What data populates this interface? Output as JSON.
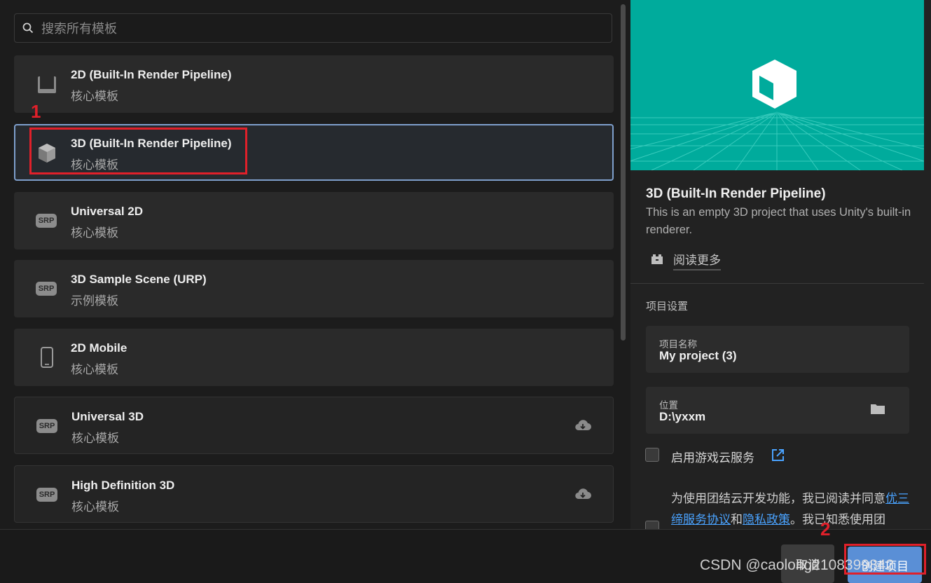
{
  "search": {
    "placeholder": "搜索所有模板"
  },
  "templates": [
    {
      "title": "2D (Built-In Render Pipeline)",
      "subtitle": "核心模板",
      "icon": "square-2d-icon"
    },
    {
      "title": "3D (Built-In Render Pipeline)",
      "subtitle": "核心模板",
      "icon": "cube-3d-icon",
      "selected": true
    },
    {
      "title": "Universal 2D",
      "subtitle": "核心模板",
      "icon": "srp-icon",
      "icon_text": "SRP"
    },
    {
      "title": "3D Sample Scene (URP)",
      "subtitle": "示例模板",
      "icon": "srp-icon",
      "icon_text": "SRP"
    },
    {
      "title": "2D Mobile",
      "subtitle": "核心模板",
      "icon": "mobile-icon"
    },
    {
      "title": "Universal 3D",
      "subtitle": "核心模板",
      "icon": "srp-icon",
      "icon_text": "SRP",
      "download": true
    },
    {
      "title": "High Definition 3D",
      "subtitle": "核心模板",
      "icon": "srp-icon",
      "icon_text": "SRP",
      "download": true
    }
  ],
  "annotations": {
    "one": "1",
    "two": "2",
    "color": "#e0202a"
  },
  "detail": {
    "title": "3D (Built-In Render Pipeline)",
    "description": "This is an empty 3D project that uses Unity's built-in renderer.",
    "read_more": "阅读更多",
    "preview_color": "#00ab9c"
  },
  "settings": {
    "section_title": "项目设置",
    "name_label": "项目名称",
    "name_value": "My project (3)",
    "location_label": "位置",
    "location_value": "D:\\yxxm",
    "cloud_label": "启用游戏云服务",
    "agree_prefix": "为使用团结云开发功能，我已阅读并同意",
    "agree_link1": "优三缔服务协议",
    "agree_mid": "和",
    "agree_link2": "隐私政策",
    "agree_suffix": "。我已知悉使用团"
  },
  "buttons": {
    "cancel": "取消",
    "create": "创建项目"
  },
  "watermark": "CSDN @caolong2108399842",
  "colors": {
    "accent": "#5a8fd6",
    "link": "#4aa3ff",
    "selected_border": "#7e9fcc"
  }
}
